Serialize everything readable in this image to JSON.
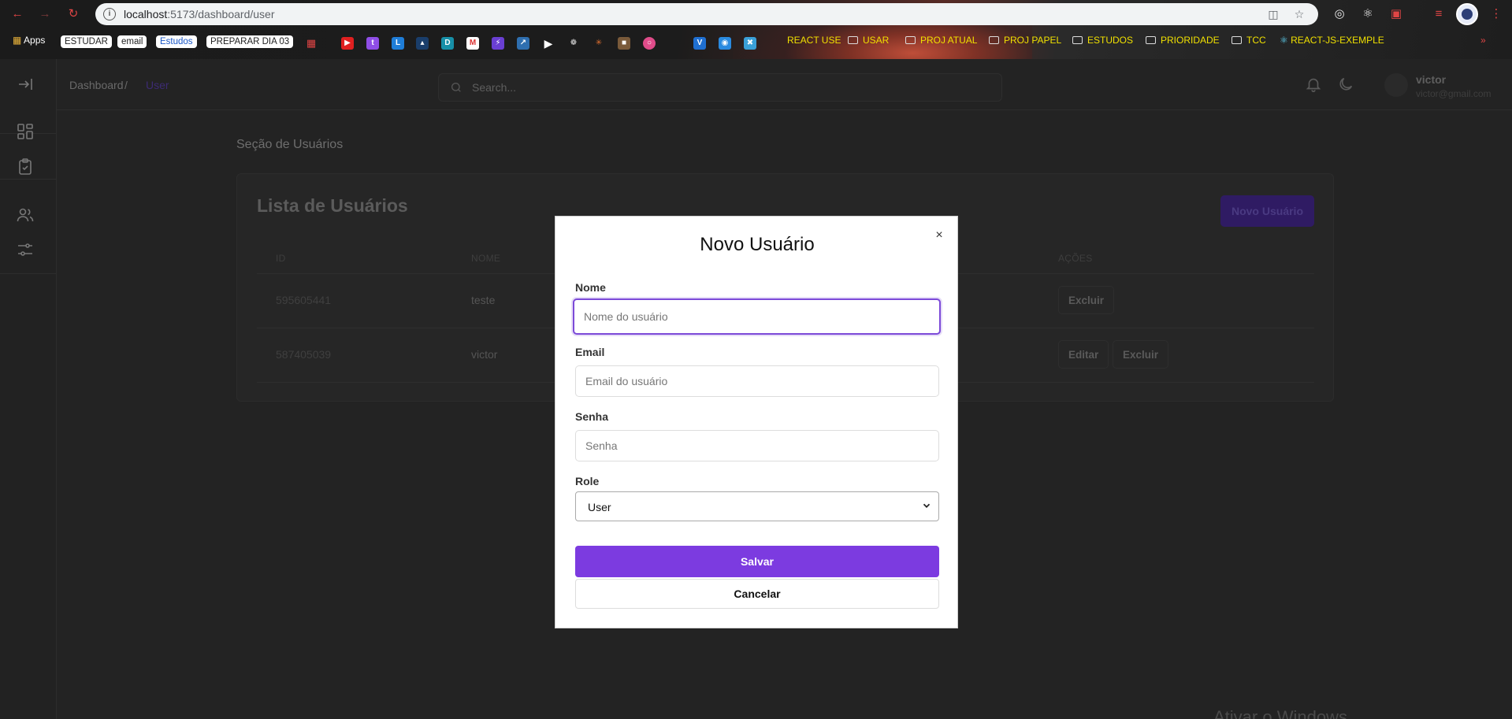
{
  "browser": {
    "url_host": "localhost",
    "url_rest": ":5173/dashboard/user",
    "bookmarks": {
      "apps": "Apps",
      "estudar": "ESTUDAR",
      "email": "email",
      "estudos_pill": "Estudos",
      "preparar": "PREPARAR DIA 03",
      "react_use": "REACT USE",
      "usar": "USAR",
      "proj_atual": "PROJ ATUAL",
      "proj_papel": "PROJ PAPEL",
      "estudos": "ESTUDOS",
      "prioridade": "PRIORIDADE",
      "tcc": "TCC",
      "react_js": "REACT-JS-EXEMPLE"
    }
  },
  "breadcrumb": {
    "root": "Dashboard",
    "separator": "/",
    "current": "User"
  },
  "search": {
    "placeholder": "Search..."
  },
  "user": {
    "name": "victor",
    "email": "victor@gmail.com"
  },
  "page": {
    "section_title": "Seção de Usuários",
    "card_title": "Lista de Usuários",
    "new_user_button": "Novo Usuário",
    "columns": {
      "id": "ID",
      "name": "NOME",
      "actions": "AÇÕES"
    },
    "rows": [
      {
        "id": "595605441",
        "name": "teste",
        "actions": [
          "Excluir"
        ]
      },
      {
        "id": "587405039",
        "name": "victor",
        "actions": [
          "Editar",
          "Excluir"
        ]
      }
    ]
  },
  "modal": {
    "title": "Novo Usuário",
    "close_glyph": "×",
    "fields": {
      "name_label": "Nome",
      "name_placeholder": "Nome do usuário",
      "email_label": "Email",
      "email_placeholder": "Email do usuário",
      "password_label": "Senha",
      "password_placeholder": "Senha",
      "role_label": "Role",
      "role_value": "User"
    },
    "save_button": "Salvar",
    "cancel_button": "Cancelar"
  },
  "watermark": "Ativar o Windows",
  "colors": {
    "accent": "#7c3be0",
    "focus_ring": "#7c4ad8",
    "chrome_red": "#e04545"
  }
}
